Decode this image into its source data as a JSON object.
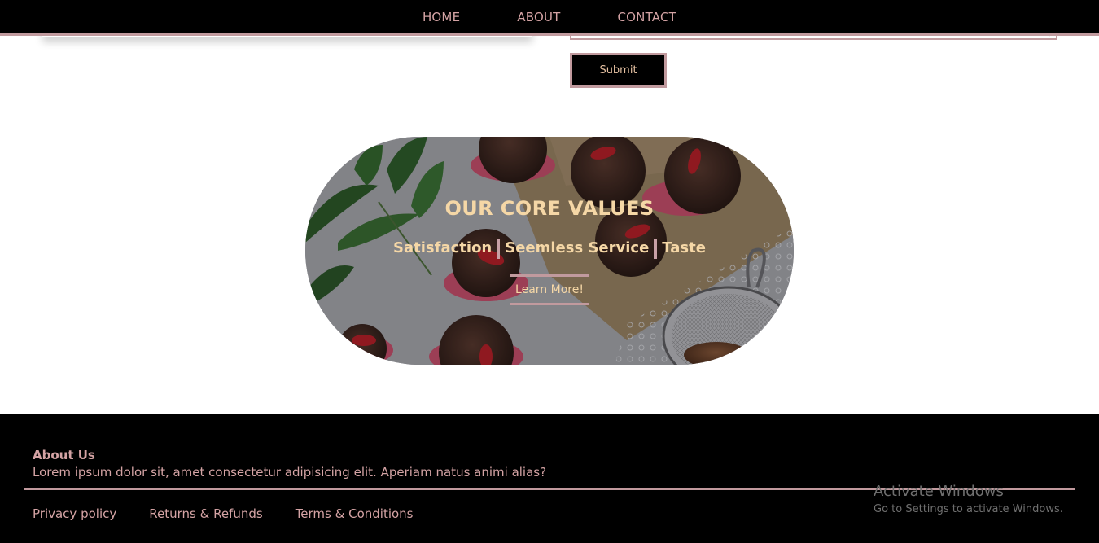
{
  "nav": {
    "items": [
      {
        "label": "HOME"
      },
      {
        "label": "ABOUT"
      },
      {
        "label": "CONTACT"
      }
    ]
  },
  "contact_form": {
    "submit_label": "Submit"
  },
  "core_values": {
    "title": "OUR CORE VALUES",
    "values": [
      "Satisfaction",
      "Seemless Service",
      "Taste"
    ],
    "button_label": "Learn More!"
  },
  "footer": {
    "about_heading": "About Us",
    "about_text": "Lorem ipsum dolor sit, amet consectetur adipisicing elit. Aperiam natus animi alias?",
    "links": [
      "Privacy policy",
      "Returns & Refunds",
      "Terms & Conditions"
    ]
  },
  "windows_watermark": {
    "title": "Activate Windows",
    "text": "Go to Settings to activate Windows."
  },
  "colors": {
    "nav_bg": "#000000",
    "accent_rose": "#c19a9e",
    "link_text": "#d4a3a4",
    "banner_text": "#f5d7a6"
  }
}
